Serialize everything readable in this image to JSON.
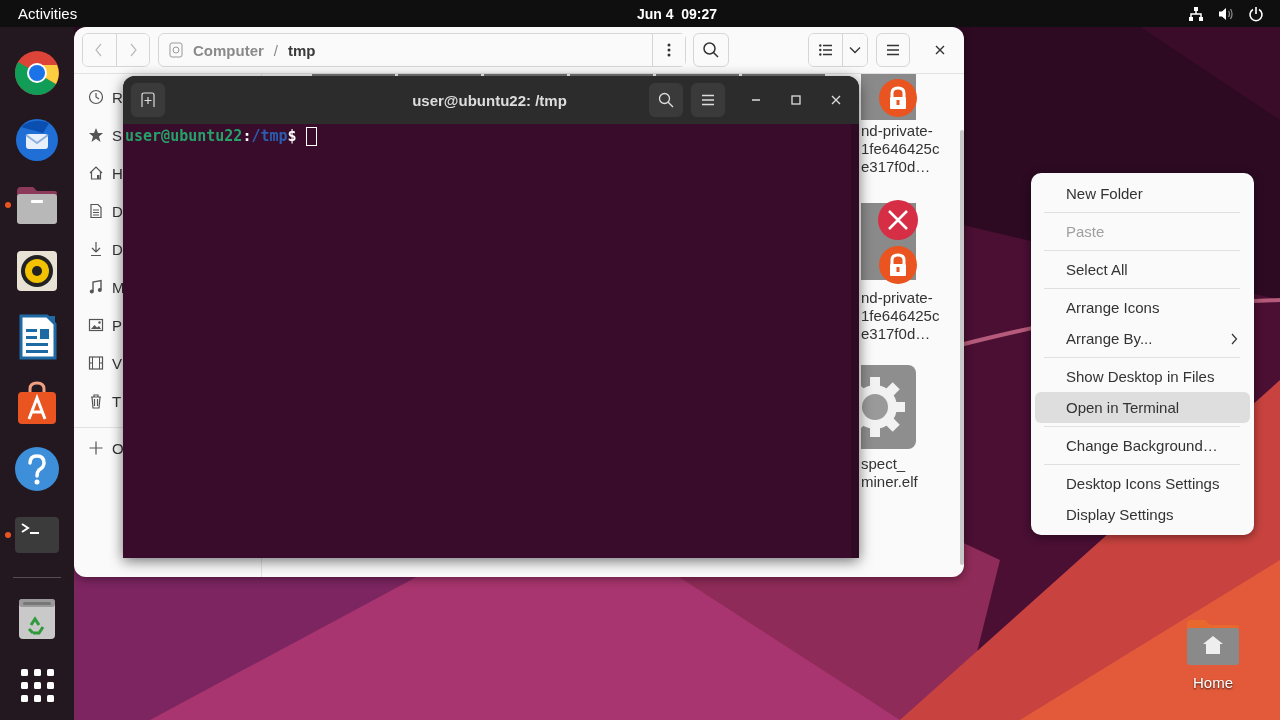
{
  "top_bar": {
    "activities": "Activities",
    "clock": "Jun 4  09:27"
  },
  "dock": {
    "apps": [
      {
        "kind": "browser",
        "running": false
      },
      {
        "kind": "mail",
        "running": false
      },
      {
        "kind": "files",
        "running": true
      },
      {
        "kind": "music",
        "running": false
      },
      {
        "kind": "writer",
        "running": false
      },
      {
        "kind": "store",
        "running": false
      },
      {
        "kind": "help",
        "running": false
      },
      {
        "kind": "terminal",
        "running": true
      }
    ],
    "extras": [
      {
        "kind": "trash",
        "running": false
      },
      {
        "kind": "app-grid",
        "running": false
      }
    ]
  },
  "files_window": {
    "back": {
      "disabled": true
    },
    "forward": {
      "disabled": true
    },
    "path": {
      "separator": "/",
      "segments": [
        {
          "label": "Computer",
          "current": false
        },
        {
          "label": "tmp",
          "current": true
        }
      ]
    },
    "sidebar": {
      "places": [
        {
          "kind": "recent",
          "label": "R"
        },
        {
          "kind": "starred",
          "label": "S"
        },
        {
          "kind": "home",
          "label": "H"
        },
        {
          "kind": "documents",
          "label": "D"
        },
        {
          "kind": "downloads",
          "label": "D"
        },
        {
          "kind": "music",
          "label": "M"
        },
        {
          "kind": "pictures",
          "label": "P"
        },
        {
          "kind": "videos",
          "label": "V"
        },
        {
          "kind": "trash",
          "label": "T"
        }
      ],
      "other": [
        {
          "kind": "other-locations",
          "label": "O"
        }
      ]
    },
    "items": [
      {
        "kind": "locked",
        "label_lines": [
          "nd-private-",
          "1fe646425c",
          "e317f0d…"
        ]
      },
      {
        "kind": "broken-locked",
        "label_lines": [
          "nd-private-",
          "1fe646425c",
          "e317f0d…"
        ]
      },
      {
        "kind": "program",
        "label_lines": [
          "spect_",
          "miner.elf"
        ]
      }
    ]
  },
  "terminal": {
    "title": "user@ubuntu22: /tmp",
    "prompt": {
      "user_host": "user@ubuntu22",
      "separator": ":",
      "path": "/tmp",
      "symbol": "$"
    }
  },
  "context_menu": {
    "groups": [
      [
        {
          "label": "New Folder",
          "disabled": false,
          "selected": false,
          "submenu": false
        }
      ],
      [
        {
          "label": "Paste",
          "disabled": true,
          "selected": false,
          "submenu": false
        }
      ],
      [
        {
          "label": "Select All",
          "disabled": false,
          "selected": false,
          "submenu": false
        }
      ],
      [
        {
          "label": "Arrange Icons",
          "disabled": false,
          "selected": false,
          "submenu": false
        },
        {
          "label": "Arrange By...",
          "disabled": false,
          "selected": false,
          "submenu": true
        }
      ],
      [
        {
          "label": "Show Desktop in Files",
          "disabled": false,
          "selected": false,
          "submenu": false
        },
        {
          "label": "Open in Terminal",
          "disabled": false,
          "selected": true,
          "submenu": false
        }
      ],
      [
        {
          "label": "Change Background…",
          "disabled": false,
          "selected": false,
          "submenu": false
        }
      ],
      [
        {
          "label": "Desktop Icons Settings",
          "disabled": false,
          "selected": false,
          "submenu": false
        },
        {
          "label": "Display Settings",
          "disabled": false,
          "selected": false,
          "submenu": false
        }
      ]
    ]
  },
  "desktop_icons": [
    {
      "kind": "home-folder",
      "label": "Home"
    }
  ]
}
